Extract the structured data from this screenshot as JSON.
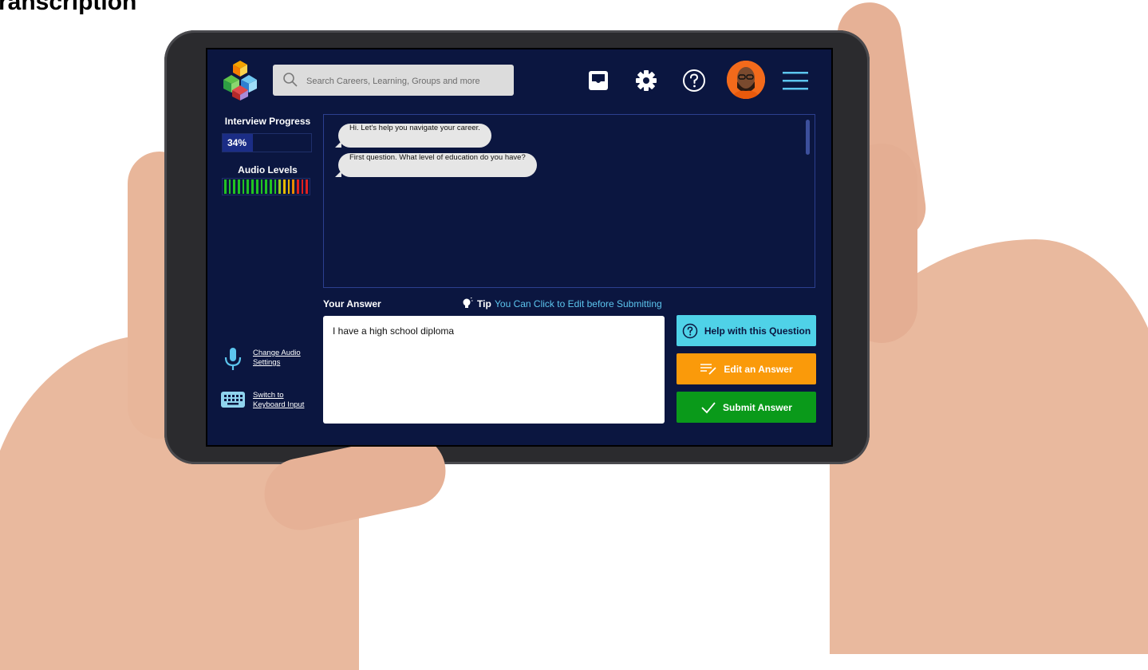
{
  "page": {
    "heading": "ranscription"
  },
  "search": {
    "placeholder": "Search Careers, Learning, Groups and more"
  },
  "sidebar": {
    "progress_title": "Interview Progress",
    "progress_value": 0.34,
    "progress_label": "34%",
    "audio_title": "Audio Levels",
    "audio_bar_colors": [
      "#22c322",
      "#22c322",
      "#22c322",
      "#22c322",
      "#22c322",
      "#22c322",
      "#22c322",
      "#22c322",
      "#22c322",
      "#22c322",
      "#22c322",
      "#22c322",
      "#9bc81e",
      "#e7b800",
      "#e7b800",
      "#e88b00",
      "#e02020",
      "#e02020",
      "#e02020"
    ],
    "change_audio_label": "Change Audio Settings",
    "switch_keyboard_label": "Switch to Keyboard Input"
  },
  "chat": {
    "messages": [
      "Hi. Let's help you navigate your career.",
      "First question. What level of education do you have?"
    ]
  },
  "answer": {
    "label": "Your Answer",
    "tip_label": "Tip",
    "tip_text": "You Can Click to Edit before Submitting",
    "value": "I have a high school diploma"
  },
  "actions": {
    "help_label": "Help with this Question",
    "edit_label": "Edit an Answer",
    "submit_label": "Submit Answer"
  },
  "colors": {
    "screen_bg": "#0b1640",
    "help_button": "#4fd2e8",
    "edit_button": "#fa9a0a",
    "submit_button": "#0a9a1a"
  }
}
